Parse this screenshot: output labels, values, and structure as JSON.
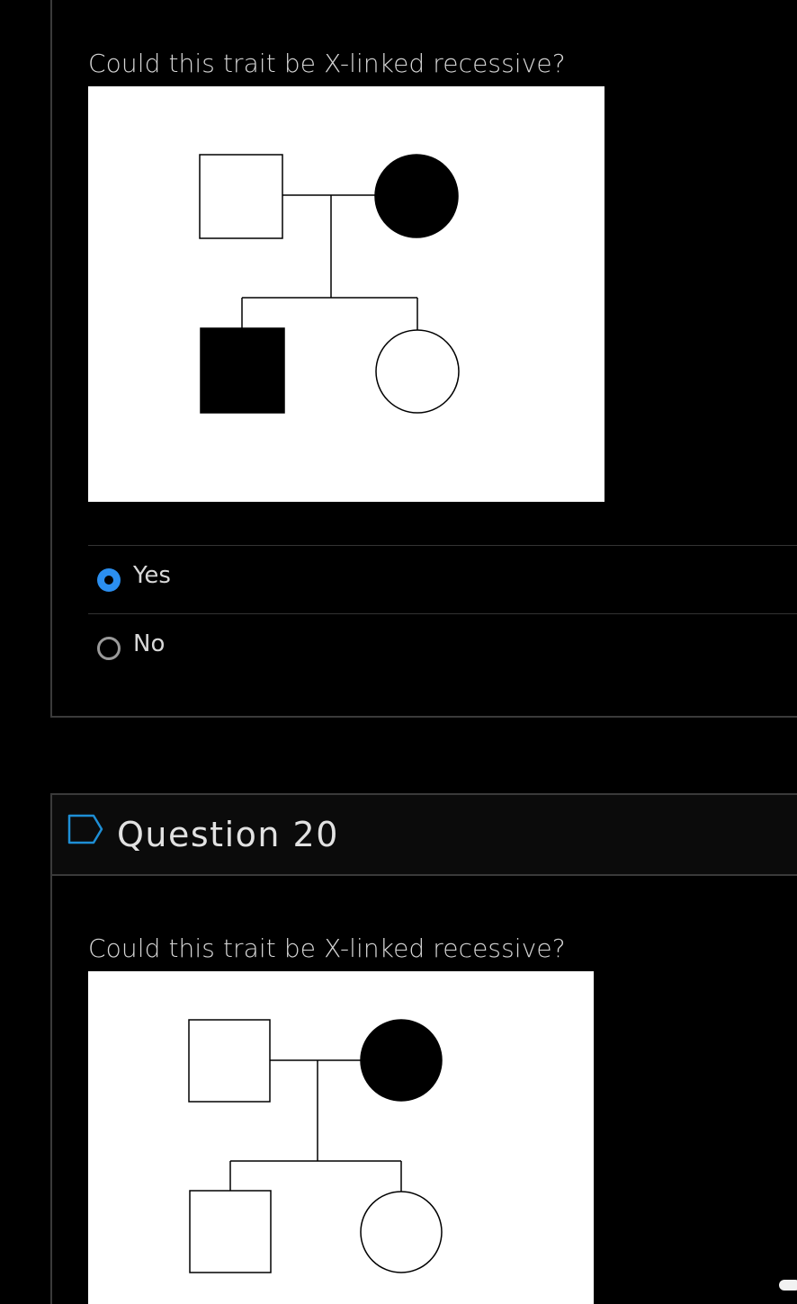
{
  "question19": {
    "prompt": "Could this trait be X-linked recessive?",
    "figure": {
      "father": "unaffected-male",
      "mother": "affected-female",
      "children": [
        "affected-male",
        "unaffected-female"
      ]
    },
    "answers": [
      {
        "label": "Yes",
        "selected": true
      },
      {
        "label": "No",
        "selected": false
      }
    ]
  },
  "question20": {
    "title": "Question 20",
    "flag_icon": "flag-outline-icon",
    "prompt": "Could this trait be X-linked recessive?",
    "figure": {
      "father": "unaffected-male",
      "mother": "affected-female",
      "children": [
        "unaffected-male",
        "unaffected-female"
      ]
    }
  },
  "colors": {
    "background": "#000000",
    "border": "#3a3a3a",
    "radio_selected": "#2b8ff0",
    "flag_stroke": "#1e8fd6"
  }
}
